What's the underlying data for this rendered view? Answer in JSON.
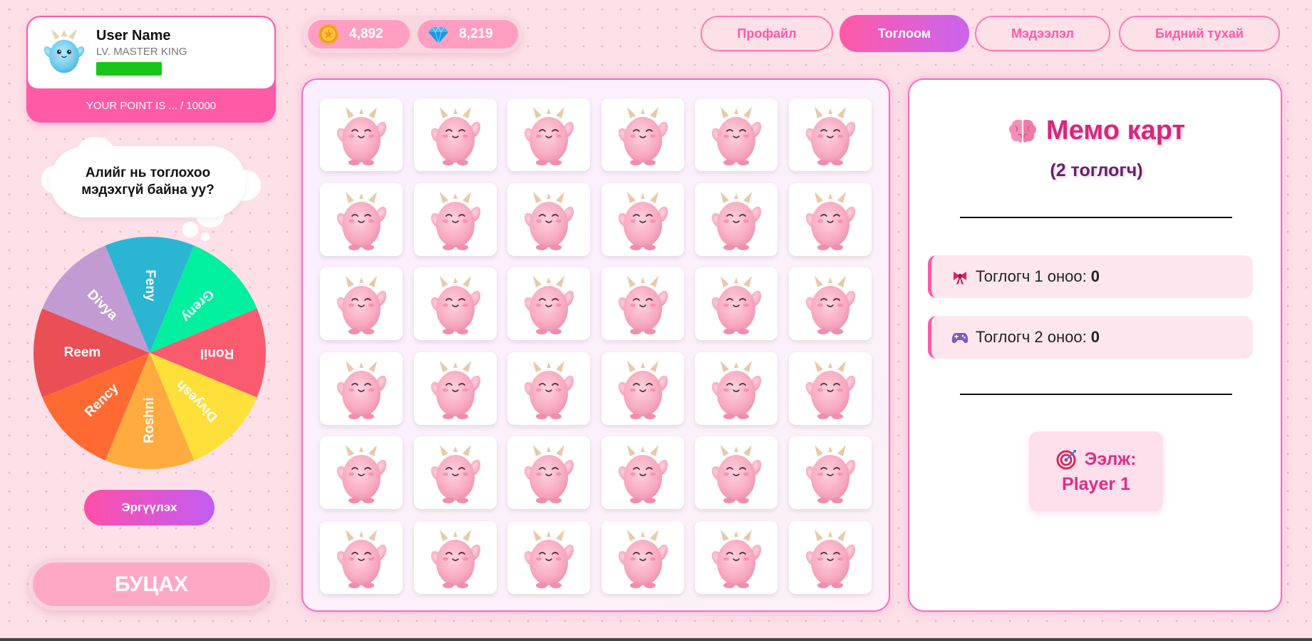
{
  "profile": {
    "name": "User Name",
    "level": "LV. MASTER KING",
    "points_text": "YOUR POINT IS ... / 10000"
  },
  "bubble": {
    "line1": "Алийг нь тоглохоо",
    "line2": "мэдэхгүй байна уу?"
  },
  "wheel": {
    "segments": [
      {
        "label": "Feny",
        "color": "#2ab5d3"
      },
      {
        "label": "Greny",
        "color": "#00f0a0"
      },
      {
        "label": "Ronil",
        "color": "#fb5b6e"
      },
      {
        "label": "Divyesh",
        "color": "#ffe03a"
      },
      {
        "label": "Roshni",
        "color": "#ffab40"
      },
      {
        "label": "Rency",
        "color": "#ff6a33"
      },
      {
        "label": "Reem",
        "color": "#e94f54"
      },
      {
        "label": "Divya",
        "color": "#c39bd3"
      }
    ],
    "spin_label": "Эргүүлэх"
  },
  "back_label": "БУЦАХ",
  "currency": {
    "coins": "4,892",
    "gems": "8,219"
  },
  "nav": {
    "profile": "Профайл",
    "games": "Тоглоом",
    "info": "Мэдээлэл",
    "about": "Бидний тухай",
    "active": "games"
  },
  "board": {
    "rows": 6,
    "cols": 6
  },
  "panel": {
    "title": "Мемо карт",
    "subtitle": "(2 тоглогч)",
    "player1_label": "Тоглогч 1 оноо:",
    "player1_score": "0",
    "player2_label": "Тоглогч 2 оноо:",
    "player2_score": "0",
    "turn_label": "Ээлж:",
    "turn_player": "Player 1"
  },
  "colors": {
    "accent": "#ff5aa6",
    "accent_purple": "#c964f0",
    "background": "#fde0e8",
    "title": "#d6277a"
  }
}
